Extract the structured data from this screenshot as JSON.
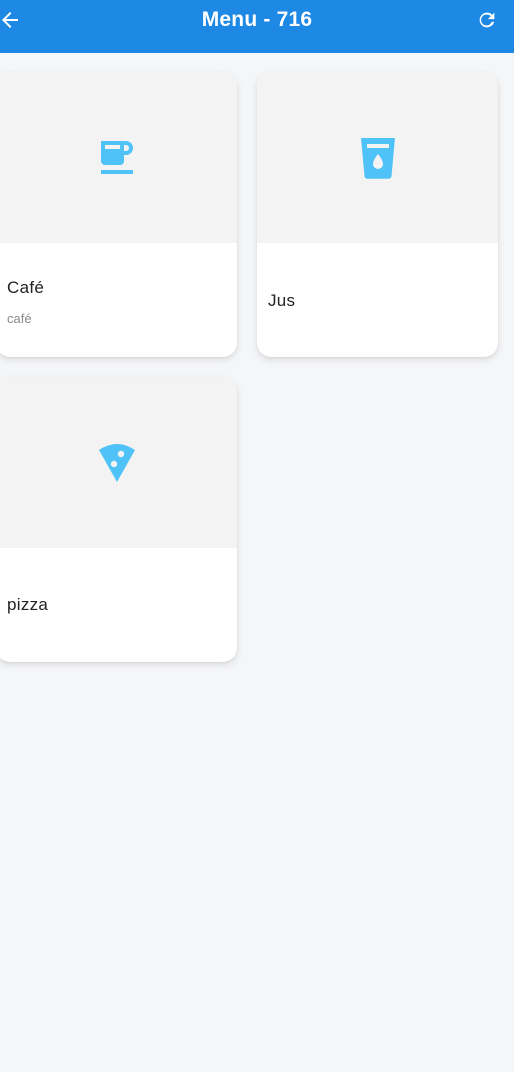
{
  "appbar": {
    "title": "Menu - 716",
    "background": "#1e88e5"
  },
  "icons": {
    "back": "arrow-left-icon",
    "refresh": "refresh-icon",
    "accent": "#4fc3f7"
  },
  "items": [
    {
      "name": "Café",
      "description": "café",
      "icon": "coffee-cup-icon"
    },
    {
      "name": "Jus",
      "description": "",
      "icon": "glass-water-drop-icon"
    },
    {
      "name": "pizza",
      "description": "",
      "icon": "pizza-slice-icon"
    }
  ]
}
